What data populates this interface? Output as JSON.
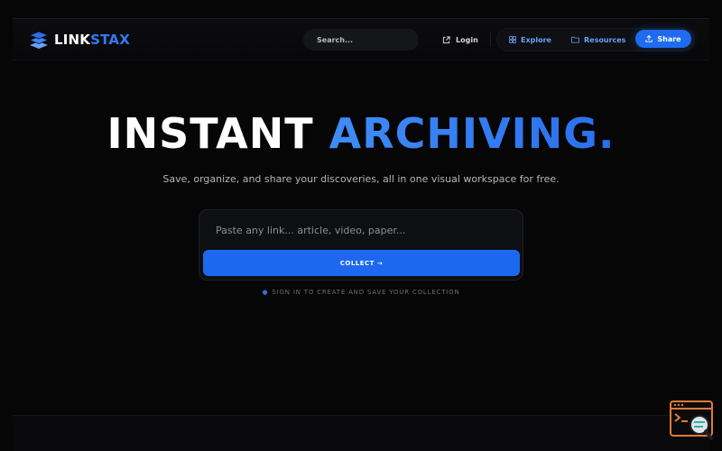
{
  "brand": {
    "name_part1": "LINK",
    "name_part2": "STAX"
  },
  "header": {
    "search_placeholder": "Search...",
    "login_label": "Login",
    "nav": [
      {
        "label": "Explore",
        "icon": "grid-icon"
      },
      {
        "label": "Resources",
        "icon": "folder-icon"
      }
    ],
    "share_label": "Share"
  },
  "hero": {
    "title_white": "INSTANT",
    "title_accent": "ARCHIVING.",
    "subtitle": "Save, organize, and share your discoveries, all in one visual workspace for free."
  },
  "collector": {
    "input_placeholder": "Paste any link... article, video, paper...",
    "input_value": "",
    "button_label": "COLLECT →"
  },
  "signin_hint": "SIGN IN TO CREATE AND SAVE YOUR COLLECTION",
  "colors": {
    "background": "#060607",
    "accent": "#1f6bf0",
    "accent_text": "#3b87f6",
    "widget_orange": "#e07a3a",
    "widget_teal": "#2fb3a8"
  }
}
